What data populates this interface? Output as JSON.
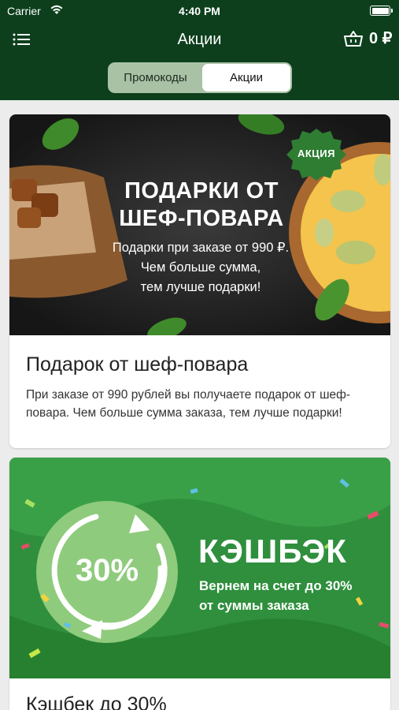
{
  "status_bar": {
    "carrier": "Carrier",
    "time": "4:40 PM"
  },
  "nav": {
    "title": "Акции",
    "cart_amount": "0 ₽"
  },
  "segments": {
    "promo_codes": "Промокоды",
    "promotions": "Акции",
    "selected": "promotions"
  },
  "colors": {
    "header": "#0d3f1d",
    "segment_track": "#a9c2a6",
    "promo_green": "#2f8f3d",
    "badge_green": "#2e7d32"
  },
  "promotions": [
    {
      "banner": {
        "badge": "АКЦИЯ",
        "headline_1": "ПОДАРКИ ОТ",
        "headline_2": "ШЕФ-ПОВАРА",
        "sub_1": "Подарки при заказе от 990 ₽.",
        "sub_2": "Чем больше сумма,",
        "sub_3": "тем лучше подарки!"
      },
      "title": "Подарок от шеф-повара",
      "description": "При заказе от 990 рублей вы получаете подарок от шеф-повара. Чем больше сумма заказа, тем лучше подарки!"
    },
    {
      "banner": {
        "percent": "30%",
        "headline": "КЭШБЭК",
        "sub_1": "Вернем на счет до 30%",
        "sub_2": "от суммы заказа"
      },
      "title": "Кэшбек до 30%"
    }
  ]
}
